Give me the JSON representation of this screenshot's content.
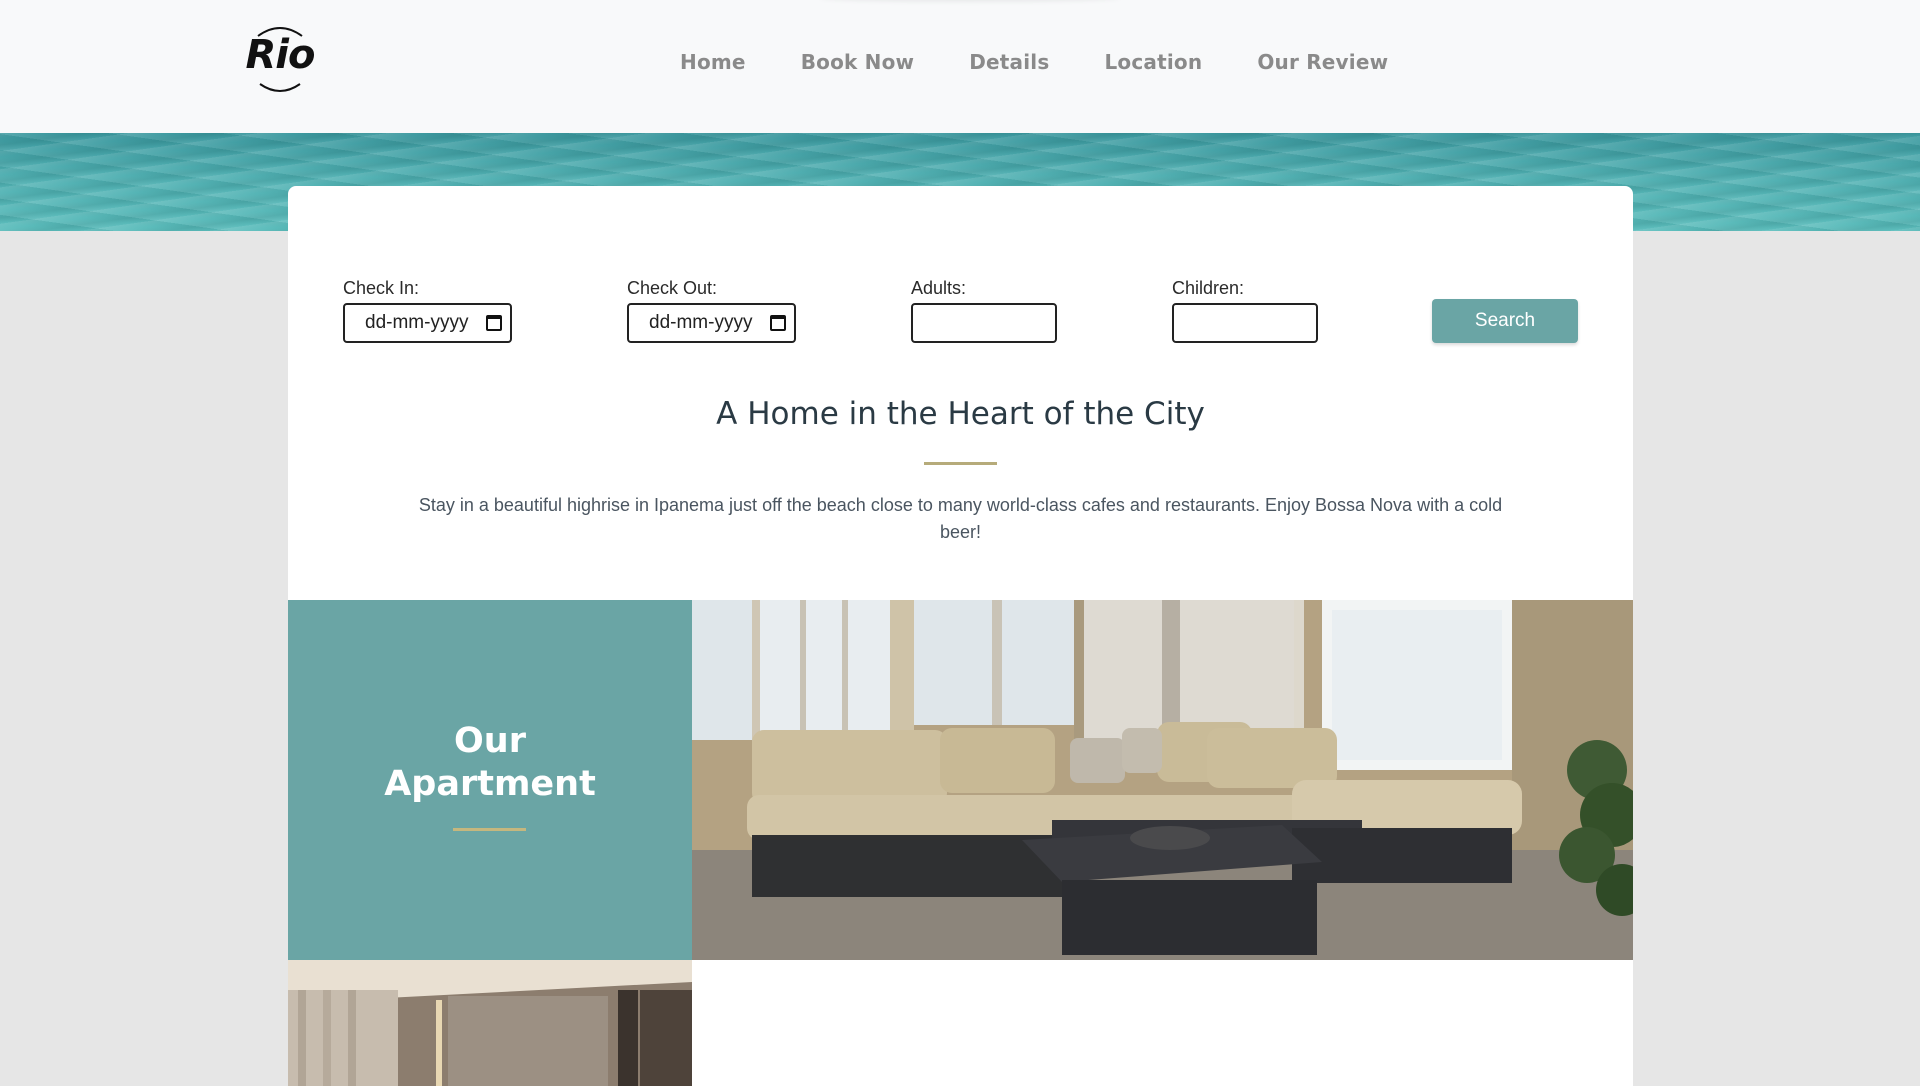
{
  "brand": {
    "logo_text": "Rio"
  },
  "nav": {
    "items": [
      {
        "label": "Home"
      },
      {
        "label": "Book Now"
      },
      {
        "label": "Details"
      },
      {
        "label": "Location"
      },
      {
        "label": "Our Review"
      }
    ]
  },
  "booking": {
    "check_in": {
      "label": "Check In:",
      "value": "dd-mm-yyyy"
    },
    "check_out": {
      "label": "Check Out:",
      "value": "dd-mm-yyyy"
    },
    "adults": {
      "label": "Adults:",
      "value": ""
    },
    "children": {
      "label": "Children:",
      "value": ""
    },
    "search_label": "Search"
  },
  "intro": {
    "headline": "A Home in the Heart of the City",
    "body": "Stay in a beautiful highrise in Ipanema just off the beach close to many world-class cafes and restaurants. Enjoy Bossa Nova with a cold beer!"
  },
  "apartment": {
    "title_line1": "Our",
    "title_line2": "Apartment"
  },
  "colors": {
    "accent_teal": "#6aa5a5",
    "rule_gold": "#b6ab7a",
    "page_bg": "#e6e6e6"
  }
}
